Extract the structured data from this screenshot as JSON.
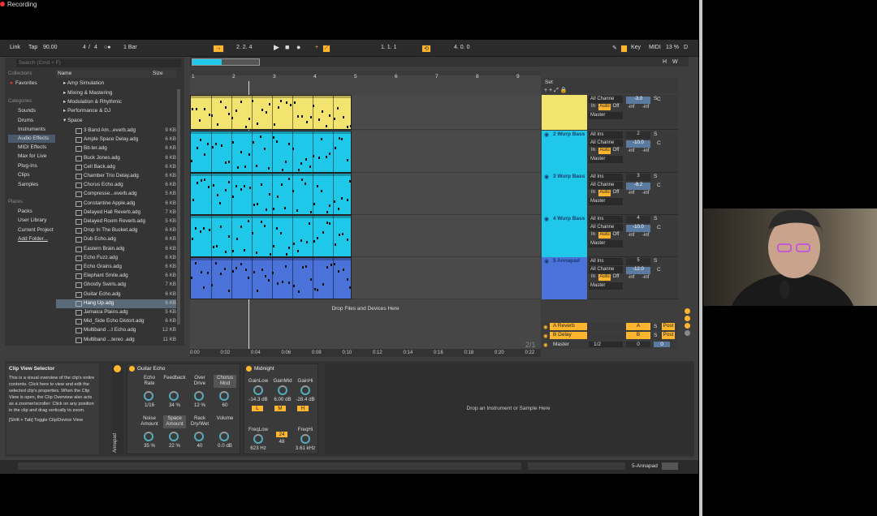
{
  "recording": {
    "label": "Recording"
  },
  "transport": {
    "link": "Link",
    "tap": "Tap",
    "tempo": "90.00",
    "sig_num": "4",
    "sig_sep": "/",
    "sig_den": "4",
    "quantize": "1 Bar",
    "position": "2.  2.  4",
    "loop_start": "1.  1.  1",
    "loop_length": "4.  0.  0",
    "key": "Key",
    "midi": "MIDI",
    "cpu": "13 %",
    "d": "D"
  },
  "browser": {
    "search_placeholder": "Search (Cmd + F)",
    "collections_header": "Collections",
    "favorites": "Favorites",
    "categories_header": "Categories",
    "categories": [
      "Sounds",
      "Drums",
      "Instruments",
      "Audio Effects",
      "MIDI Effects",
      "Max for Live",
      "Plug-Ins",
      "Clips",
      "Samples"
    ],
    "places_header": "Places",
    "places": [
      "Packs",
      "User Library",
      "Current Project",
      "Add Folder..."
    ],
    "col_name": "Name",
    "col_size": "Size",
    "folders": [
      "Amp Simulation",
      "Mixing & Mastering",
      "Modulation & Rhythmic",
      "Performance & DJ",
      "Space"
    ],
    "files": [
      {
        "name": "3 Band Am...everb.adg",
        "size": "9 KB"
      },
      {
        "name": "Ample Space Delay.adg",
        "size": "6 KB"
      },
      {
        "name": "Bit-ter.adg",
        "size": "6 KB"
      },
      {
        "name": "Buck Jones.adg",
        "size": "6 KB"
      },
      {
        "name": "Cell Back.adg",
        "size": "6 KB"
      },
      {
        "name": "Chamber Trio Delay.adg",
        "size": "6 KB"
      },
      {
        "name": "Chorus Echo.adg",
        "size": "6 KB"
      },
      {
        "name": "Compresse...everb.adg",
        "size": "5 KB"
      },
      {
        "name": "Constantine Apple.adg",
        "size": "6 KB"
      },
      {
        "name": "Delayed Hall Reverb.adg",
        "size": "7 KB"
      },
      {
        "name": "Delayed Room Reverb.adg",
        "size": "5 KB"
      },
      {
        "name": "Drop In The Bucket.adg",
        "size": "6 KB"
      },
      {
        "name": "Dub Echo.adg",
        "size": "6 KB"
      },
      {
        "name": "Eastern Brain.adg",
        "size": "6 KB"
      },
      {
        "name": "Echo Fuzz.adg",
        "size": "6 KB"
      },
      {
        "name": "Echo Grains.adg",
        "size": "6 KB"
      },
      {
        "name": "Elephant Smile.adg",
        "size": "6 KB"
      },
      {
        "name": "Ghostly Swirls.adg",
        "size": "7 KB"
      },
      {
        "name": "Guitar Echo.adg",
        "size": "6 KB"
      },
      {
        "name": "Hang Up.adg",
        "size": "6 KB"
      },
      {
        "name": "Jamaica Plains.adg",
        "size": "5 KB"
      },
      {
        "name": "Mid_Side Echo Distort.adg",
        "size": "6 KB"
      },
      {
        "name": "Multiband ...t Echo.adg",
        "size": "12 KB"
      },
      {
        "name": "Multiband ...tereo .adg",
        "size": "11 KB"
      }
    ]
  },
  "ruler": {
    "bars": [
      "1",
      "2",
      "3",
      "4",
      "5",
      "6",
      "7",
      "8",
      "9"
    ],
    "times": [
      "0:00",
      "0:02",
      "0:04",
      "0:06",
      "0:08",
      "0:10",
      "0:12",
      "0:14",
      "0:16",
      "0:18",
      "0:20",
      "0:22"
    ]
  },
  "arrangement": {
    "drop_text": "Drop Files and Devices Here",
    "zoom": "2/1",
    "set_label": "Set"
  },
  "tracks": [
    {
      "name": "",
      "color": "#f2e46e",
      "in": "All Channe",
      "mon": "Master",
      "vol": "-3.0",
      "num": "",
      "pan": "C",
      "inf1": "-inf",
      "inf2": "-inf"
    },
    {
      "name": "2 Wurp Bass",
      "color": "#1fc8e8",
      "src": "All Ins",
      "in": "All Channe",
      "mon": "Master",
      "vol": "-10.0",
      "num": "2",
      "pan": "C",
      "inf1": "-inf",
      "inf2": "-inf"
    },
    {
      "name": "3 Wurp Bass",
      "color": "#1fc8e8",
      "src": "All Ins",
      "in": "All Channe",
      "mon": "Master",
      "vol": "-8.2",
      "num": "3",
      "pan": "C",
      "inf1": "-inf",
      "inf2": "-inf"
    },
    {
      "name": "4 Wurp Bass",
      "color": "#1fc8e8",
      "src": "All Ins",
      "in": "All Channe",
      "mon": "Master",
      "vol": "-10.0",
      "num": "4",
      "pan": "C",
      "inf1": "-inf",
      "inf2": "-inf"
    },
    {
      "name": "5 Annapad",
      "color": "#4a72d8",
      "src": "All Ins",
      "in": "All Channe",
      "mon": "Master",
      "vol": "-12.0",
      "num": "5",
      "pan": "C",
      "inf1": "-inf",
      "inf2": "-inf"
    }
  ],
  "returns": [
    {
      "name": "A Reverb",
      "letter": "A",
      "s": "S",
      "post": "Post"
    },
    {
      "name": "B Delay",
      "letter": "B",
      "s": "S",
      "post": "Post"
    }
  ],
  "master": {
    "name": "Master",
    "fraction": "1/2",
    "vol": "0",
    "val": "0"
  },
  "monitor_labels": {
    "in": "In",
    "auto": "Auto",
    "off": "Off",
    "s": "S"
  },
  "info": {
    "title": "Clip View Selector",
    "body": "This is a visual overview of the clip's entire contents. Click here to view and edit the selected clip's properties. When the Clip View is open, the Clip Overview also acts as a zoomer/scroller: Click on any position in the clip and drag vertically to zoom.",
    "shortcut": "[Shift + Tab] Toggle Clip/Device View"
  },
  "rack_label": "Annapad",
  "guitar_echo": {
    "title": "Guitar Echo",
    "knobs": [
      {
        "label": "Echo Rate",
        "value": "1/16"
      },
      {
        "label": "Feedback",
        "value": "34 %"
      },
      {
        "label": "Over Drive",
        "value": "12 %"
      },
      {
        "label": "Chorus Mod",
        "value": "60"
      },
      {
        "label": "Noise Amount",
        "value": "35 %"
      },
      {
        "label": "Space Amount",
        "value": "22 %"
      },
      {
        "label": "Rack Dry/Wet",
        "value": "40"
      },
      {
        "label": "Volume",
        "value": "0.0 dB"
      }
    ]
  },
  "midnight": {
    "title": "Midnight",
    "knobs": [
      {
        "label": "GainLow",
        "value": "-14.3 dB"
      },
      {
        "label": "GainMid",
        "value": "6.00 dB"
      },
      {
        "label": "GainHi",
        "value": "-28.4 dB"
      },
      {
        "label": "FreqLow",
        "value": "623 Hz"
      },
      {
        "label": "FreqHi",
        "value": "3.61 kHz"
      }
    ],
    "buttons": [
      "L",
      "M",
      "H"
    ],
    "slope1": "24",
    "slope2": "48"
  },
  "device_drop": "Drop an Instrument or Sample Here",
  "status": {
    "track": "5-Annapad"
  }
}
